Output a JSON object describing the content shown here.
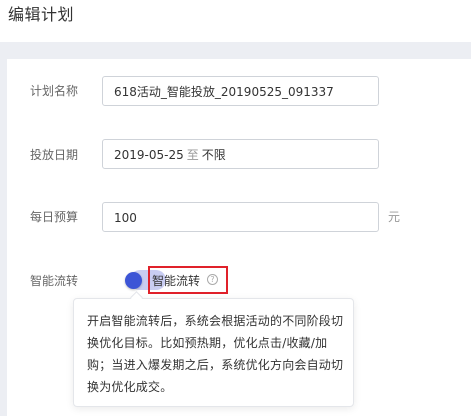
{
  "header": {
    "title": "编辑计划"
  },
  "form": {
    "plan_name": {
      "label": "计划名称",
      "value": "618活动_智能投放_20190525_091337"
    },
    "date": {
      "label": "投放日期",
      "start": "2019-05-25",
      "separator": "至",
      "end": "不限"
    },
    "budget": {
      "label": "每日预算",
      "value": "100",
      "unit": "元"
    },
    "smart_flow": {
      "label": "智能流转",
      "toggle_on": true,
      "toggle_label": "智能流转",
      "help_icon": "question-circle-icon",
      "help_icon_glyph": "?",
      "tooltip": "开启智能流转后，系统会根据活动的不同阶段切换优化目标。比如预热期，优化点击/收藏/加购；当进入爆发期之后，系统优化方向会自动切换为优化成交。"
    }
  },
  "colors": {
    "toggle_knob": "#3d55d6",
    "toggle_track": "#c9cdf2",
    "highlight_border": "#e0212a"
  }
}
